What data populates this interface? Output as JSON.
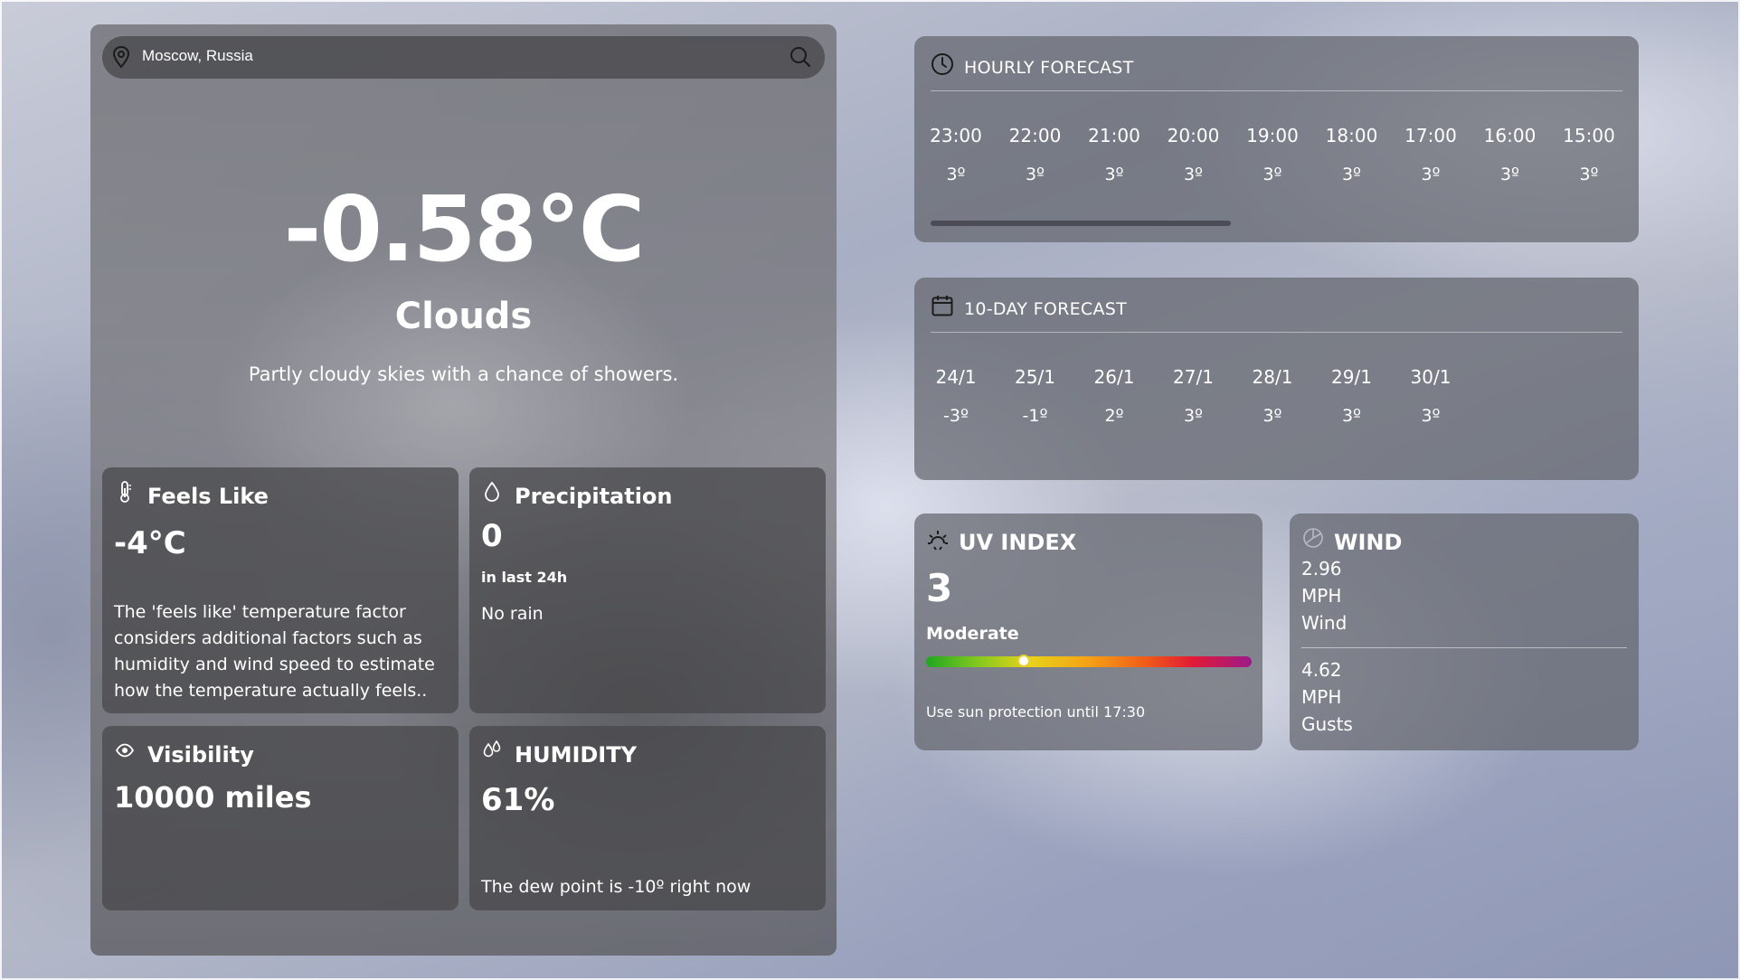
{
  "search": {
    "location": "Moscow, Russia"
  },
  "current": {
    "temperature": "-0.58°C",
    "condition": "Clouds",
    "description": "Partly cloudy skies with a chance of showers."
  },
  "tiles": {
    "feels_like": {
      "title": "Feels Like",
      "value": "-4°C",
      "text": "The 'feels like' temperature factor considers additional factors such as humidity and wind speed to estimate how the temperature actually feels.."
    },
    "precipitation": {
      "title": "Precipitation",
      "value": "0",
      "sub": "in last 24h",
      "text": "No rain"
    },
    "visibility": {
      "title": "Visibility",
      "value": "10000 miles"
    },
    "humidity": {
      "title": "HUMIDITY",
      "value": "61%",
      "text": "The dew point is -10º right now"
    }
  },
  "hourly": {
    "title": "HOURLY FORECAST",
    "items": [
      {
        "time": "23:00",
        "temp": "3º"
      },
      {
        "time": "22:00",
        "temp": "3º"
      },
      {
        "time": "21:00",
        "temp": "3º"
      },
      {
        "time": "20:00",
        "temp": "3º"
      },
      {
        "time": "19:00",
        "temp": "3º"
      },
      {
        "time": "18:00",
        "temp": "3º"
      },
      {
        "time": "17:00",
        "temp": "3º"
      },
      {
        "time": "16:00",
        "temp": "3º"
      },
      {
        "time": "15:00",
        "temp": "3º"
      }
    ]
  },
  "daily": {
    "title": "10-DAY FORECAST",
    "items": [
      {
        "date": "24/1",
        "temp": "-3º"
      },
      {
        "date": "25/1",
        "temp": "-1º"
      },
      {
        "date": "26/1",
        "temp": "2º"
      },
      {
        "date": "27/1",
        "temp": "3º"
      },
      {
        "date": "28/1",
        "temp": "3º"
      },
      {
        "date": "29/1",
        "temp": "3º"
      },
      {
        "date": "30/1",
        "temp": "3º"
      }
    ]
  },
  "uv": {
    "title": "UV INDEX",
    "value": "3",
    "level": "Moderate",
    "bar_fraction": 0.3,
    "note": "Use sun protection until 17:30"
  },
  "wind": {
    "title": "WIND",
    "wind_speed": "2.96",
    "wind_unit": "MPH",
    "wind_label": "Wind",
    "gust_speed": "4.62",
    "gust_unit": "MPH",
    "gust_label": "Gusts"
  },
  "icons": {
    "location": "map-pin-icon",
    "search": "search-icon",
    "feels_like": "thermometer-icon",
    "precipitation": "droplet-icon",
    "visibility": "eye-icon",
    "humidity": "droplets-icon",
    "hourly": "clock-icon",
    "daily": "calendar-icon",
    "uv": "sun-icon",
    "wind": "wind-icon"
  }
}
